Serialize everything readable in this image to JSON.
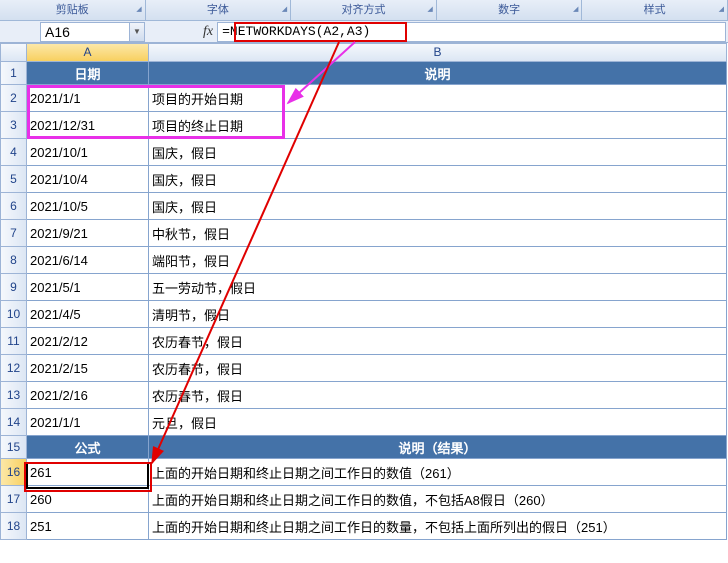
{
  "ribbon": {
    "groups": [
      "剪贴板",
      "字体",
      "对齐方式",
      "数字",
      "样式"
    ]
  },
  "namebox": {
    "value": "A16"
  },
  "formula_bar": {
    "fx_label": "fx",
    "value": "=NETWORKDAYS(A2,A3)"
  },
  "columns": {
    "A": "A",
    "B": "B"
  },
  "header1": {
    "A": "日期",
    "B": "说明"
  },
  "rows": [
    {
      "n": 2,
      "A": "2021/1/1",
      "B": "项目的开始日期"
    },
    {
      "n": 3,
      "A": "2021/12/31",
      "B": "项目的终止日期"
    },
    {
      "n": 4,
      "A": "2021/10/1",
      "B": "国庆，假日"
    },
    {
      "n": 5,
      "A": "2021/10/4",
      "B": "国庆，假日"
    },
    {
      "n": 6,
      "A": "2021/10/5",
      "B": "国庆，假日"
    },
    {
      "n": 7,
      "A": "2021/9/21",
      "B": "中秋节，假日"
    },
    {
      "n": 8,
      "A": "2021/6/14",
      "B": "端阳节，假日"
    },
    {
      "n": 9,
      "A": "2021/5/1",
      "B": "五一劳动节，假日"
    },
    {
      "n": 10,
      "A": "2021/4/5",
      "B": "清明节，假日"
    },
    {
      "n": 11,
      "A": "2021/2/12",
      "B": "农历春节，假日"
    },
    {
      "n": 12,
      "A": "2021/2/15",
      "B": "农历春节，假日"
    },
    {
      "n": 13,
      "A": "2021/2/16",
      "B": "农历春节，假日"
    },
    {
      "n": 14,
      "A": "2021/1/1",
      "B": "元旦，假日"
    }
  ],
  "header2": {
    "A": "公式",
    "B": "说明（结果）"
  },
  "results": [
    {
      "n": 16,
      "A": "261",
      "B": "上面的开始日期和终止日期之间工作日的数值（261）"
    },
    {
      "n": 17,
      "A": "260",
      "B": "上面的开始日期和终止日期之间工作日的数值，不包括A8假日（260）"
    },
    {
      "n": 18,
      "A": "251",
      "B": "上面的开始日期和终止日期之间工作日的数量，不包括上面所列出的假日（251）"
    }
  ]
}
